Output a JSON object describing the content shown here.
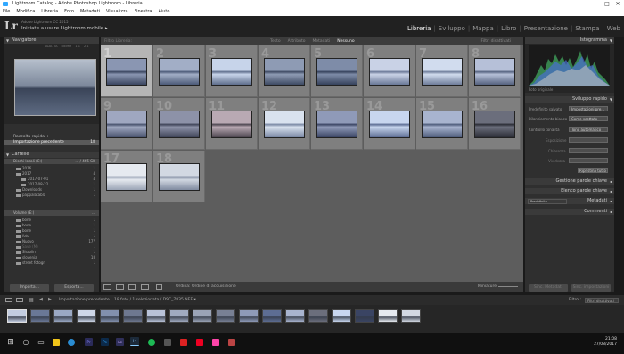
{
  "window": {
    "title": "Lightroom Catalog - Adobe Photoshop Lightroom - Libreria",
    "controls": [
      "–",
      "□",
      "✕"
    ]
  },
  "menu": [
    "File",
    "Modifica",
    "Libreria",
    "Foto",
    "Metadati",
    "Visualizza",
    "Finestra",
    "Aiuto"
  ],
  "identity": {
    "logo": "Lr",
    "line1": "Adobe Lightroom CC 2015",
    "line2": "Iniziate a usare Lightroom mobile ▸"
  },
  "modules": [
    {
      "label": "Libreria",
      "active": true
    },
    {
      "label": "Sviluppo",
      "active": false
    },
    {
      "label": "Mappa",
      "active": false
    },
    {
      "label": "Libro",
      "active": false
    },
    {
      "label": "Presentazione",
      "active": false
    },
    {
      "label": "Stampa",
      "active": false
    },
    {
      "label": "Web",
      "active": false
    }
  ],
  "left": {
    "navigator": {
      "title": "Navigatore",
      "modes": [
        "ADATTA",
        "RIEMPI",
        "1:1",
        "2:1"
      ]
    },
    "catalog_rows": [
      {
        "label": "Raccolta rapida +",
        "count": ""
      },
      {
        "label": "Importazione precedente",
        "count": "18"
      }
    ],
    "catalog_head": "Cataloghi",
    "folders_head": "Cartelle",
    "disk": {
      "label": "Dischi locali (C:)",
      "value": "… / 465 GB"
    },
    "folders": [
      {
        "label": "2016",
        "count": "1"
      },
      {
        "label": "2017",
        "count": "4"
      },
      {
        "label": "2017-07-01",
        "count": "4"
      },
      {
        "label": "2017-08-22",
        "count": "1"
      },
      {
        "label": "Downloads",
        "count": "1"
      },
      {
        "label": "pappalatabla",
        "count": "1"
      }
    ],
    "volume2": {
      "label": "Volume (E:)",
      "value": "…"
    },
    "folders2": [
      {
        "label": "bone",
        "count": "1"
      },
      {
        "label": "bone",
        "count": "1"
      },
      {
        "label": "bone",
        "count": "1"
      },
      {
        "label": "foto",
        "count": "1"
      },
      {
        "label": "Nuovo",
        "count": "177"
      },
      {
        "label": "Save (M)",
        "count": "1"
      },
      {
        "label": "Shaolin",
        "count": "1"
      },
      {
        "label": "slovenia",
        "count": "18"
      },
      {
        "label": "street fotogr",
        "count": "1"
      }
    ],
    "import_btn": "Importa...",
    "export_btn": "Esporta..."
  },
  "filterbar": {
    "title": "Filtro Libreria:",
    "tabs": [
      {
        "label": "Testo",
        "active": false
      },
      {
        "label": "Attributo",
        "active": false
      },
      {
        "label": "Metadati",
        "active": false
      },
      {
        "label": "Nessuno",
        "active": true
      }
    ],
    "right": "Filtri disattivati"
  },
  "grid": {
    "selected": [
      1
    ],
    "numbers": [
      "1",
      "2",
      "3",
      "4",
      "5",
      "6",
      "7",
      "8",
      "9",
      "10",
      "11",
      "12",
      "13",
      "14",
      "15",
      "16",
      "17",
      "18"
    ]
  },
  "toolbar": {
    "sort_label": "Ordina: Ordine di acquisizione",
    "thumbs_label": "Miniature"
  },
  "right": {
    "histogram_head": "Istogramma",
    "original_label": "Foto originale",
    "quick_head": "Sviluppo rapido",
    "rows": [
      {
        "label": "Predefinito salvato",
        "value": "Impostazioni pre..."
      },
      {
        "label": "Bilanciamento bianco",
        "value": "Come scattato"
      },
      {
        "label": "Controllo tonalità",
        "value": "Tono automatico"
      },
      {
        "label": "Esposizione",
        "value": ""
      },
      {
        "label": "Chiarezza",
        "value": ""
      },
      {
        "label": "Vividezza",
        "value": ""
      }
    ],
    "reset_btn": "Ripristina tutto",
    "keywords_head": "Gestione parole chiave",
    "keywordlist_head": "Elenco parole chiave",
    "metadata_head": "Metadati",
    "metadata_preset": "Predefinito",
    "comments_head": "Commenti",
    "sync_btn": "Sinc. Metadati",
    "sync2_btn": "Sinc. impostazioni"
  },
  "filmbar": {
    "path": "Importazione precedente",
    "info": "18 foto / 1 selezionata / DSC_7835.NEF ▾",
    "filter_label": "Filtro :",
    "filter_value": "Filtri disattivati"
  },
  "taskbar": {
    "time": "21:08",
    "date": "27/08/2017"
  }
}
